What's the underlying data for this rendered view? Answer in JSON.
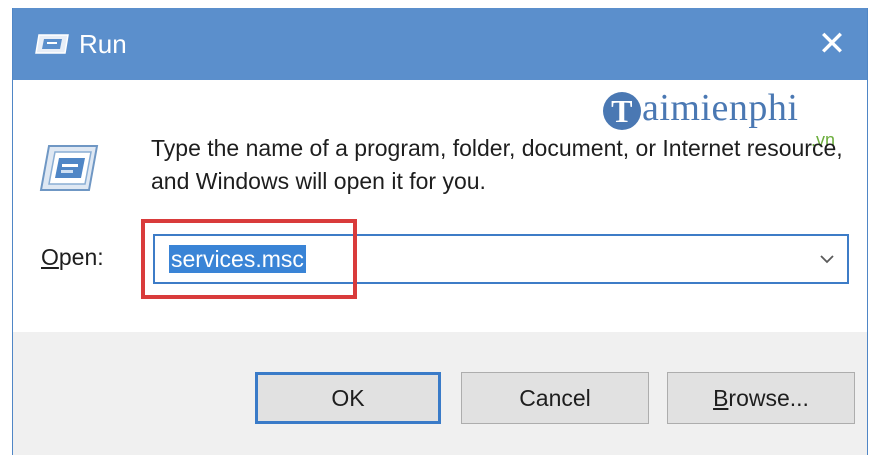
{
  "window": {
    "title": "Run",
    "close_glyph": "✕"
  },
  "body": {
    "description": "Type the name of a program, folder, document, or Internet resource, and Windows will open it for you.",
    "watermark": {
      "mark": "T",
      "text": "aimienphi",
      "sub": ".vn"
    }
  },
  "open_field": {
    "label_accel": "O",
    "label_rest": "pen:",
    "value": "services.msc",
    "selected": true
  },
  "buttons": {
    "ok": "OK",
    "cancel": "Cancel",
    "browse_accel": "B",
    "browse_rest": "rowse..."
  },
  "icons": {
    "title": "run-app-icon",
    "body": "run-program-icon",
    "dropdown": "chevron-down-icon",
    "close": "close-icon"
  },
  "colors": {
    "titlebar": "#5b8fcc",
    "selection": "#3a84d6",
    "focus_border": "#3d7cc7",
    "highlight_annotation": "#d93b3b",
    "footer": "#f0f0f0"
  }
}
